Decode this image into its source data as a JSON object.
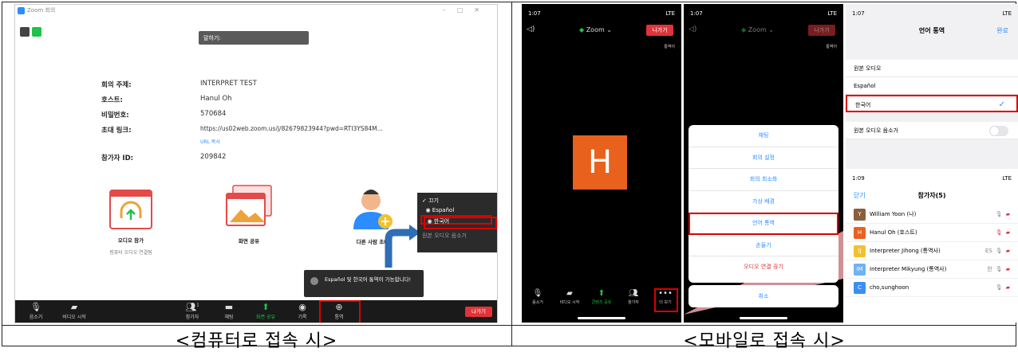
{
  "captions": {
    "left": "<컴퓨터로 접속 시>",
    "right": "<모바일로 접속 시>"
  },
  "desktop": {
    "title": "Zoom 회의",
    "talking": "말하기:",
    "info": [
      {
        "key": "회의 주제:",
        "value": "INTERPRET TEST"
      },
      {
        "key": "호스트:",
        "value": "Hanul Oh"
      },
      {
        "key": "비밀번호:",
        "value": "570684"
      },
      {
        "key": "초대 링크:",
        "value": "https://us02web.zoom.us/j/82679823944?pwd=RTI3YS84M..."
      }
    ],
    "url_copy": "URL 복사",
    "participant_id_key": "참가자 ID:",
    "participant_id_value": "209842",
    "tiles": {
      "audio_join": "오디오 참가",
      "audio_sub": "컴퓨터 오디오 연결됨",
      "screen_share": "화면 공유",
      "invite": "다른 사람 초대"
    },
    "lang_menu": {
      "off": "끄기",
      "spanish": "Español",
      "korean": "한국어",
      "mute_original": "원본 오디오 음소거"
    },
    "toast": "Español 및 한국어 통역이 가능합니다!",
    "toolbar": {
      "mute": "음소거",
      "video": "비디오 시작",
      "participants": "참가자",
      "participants_count": "1",
      "chat": "채팅",
      "share": "화면 공유",
      "record": "기록",
      "interpret": "통역",
      "leave": "나가기"
    }
  },
  "mobile": {
    "time": "1:07",
    "time2": "1:09",
    "signal": "LTE",
    "zoom": "Zoom",
    "leave": "나가기",
    "interp_badge": "통역어",
    "avatar": "H",
    "toolbar": {
      "mute": "음소거",
      "video": "비디오 시작",
      "share": "콘텐츠 공유",
      "participants": "참가자",
      "more": "더 보기"
    },
    "menu": [
      "채팅",
      "회의 설정",
      "회의 최소화",
      "가상 배경",
      "언어 통역",
      "손들기",
      "오디오 연결 끊기"
    ],
    "cancel": "취소",
    "lang_screen": {
      "title": "언어 통역",
      "done": "완료",
      "options": [
        "원본 오디오",
        "Español",
        "한국어"
      ],
      "mute_original": "원본 오디오 음소거"
    },
    "participants_screen": {
      "close": "닫기",
      "title": "참가자(5)",
      "list": [
        {
          "initial": "Y",
          "name": "William Yoon (나)",
          "color": "#8b5e3c",
          "tag": ""
        },
        {
          "initial": "H",
          "name": "Hanul Oh (호스트)",
          "color": "#e8621e",
          "tag": ""
        },
        {
          "initial": "IJ",
          "name": "Interpreter Jihong (통역사)",
          "color": "#f2c12e",
          "tag": "ES"
        },
        {
          "initial": "IM",
          "name": "Interpreter Mikyung (통역사)",
          "color": "#6fb3f2",
          "tag": "한"
        },
        {
          "initial": "C",
          "name": "cho,sunghoon",
          "color": "#3a8ef5",
          "tag": ""
        }
      ]
    }
  }
}
